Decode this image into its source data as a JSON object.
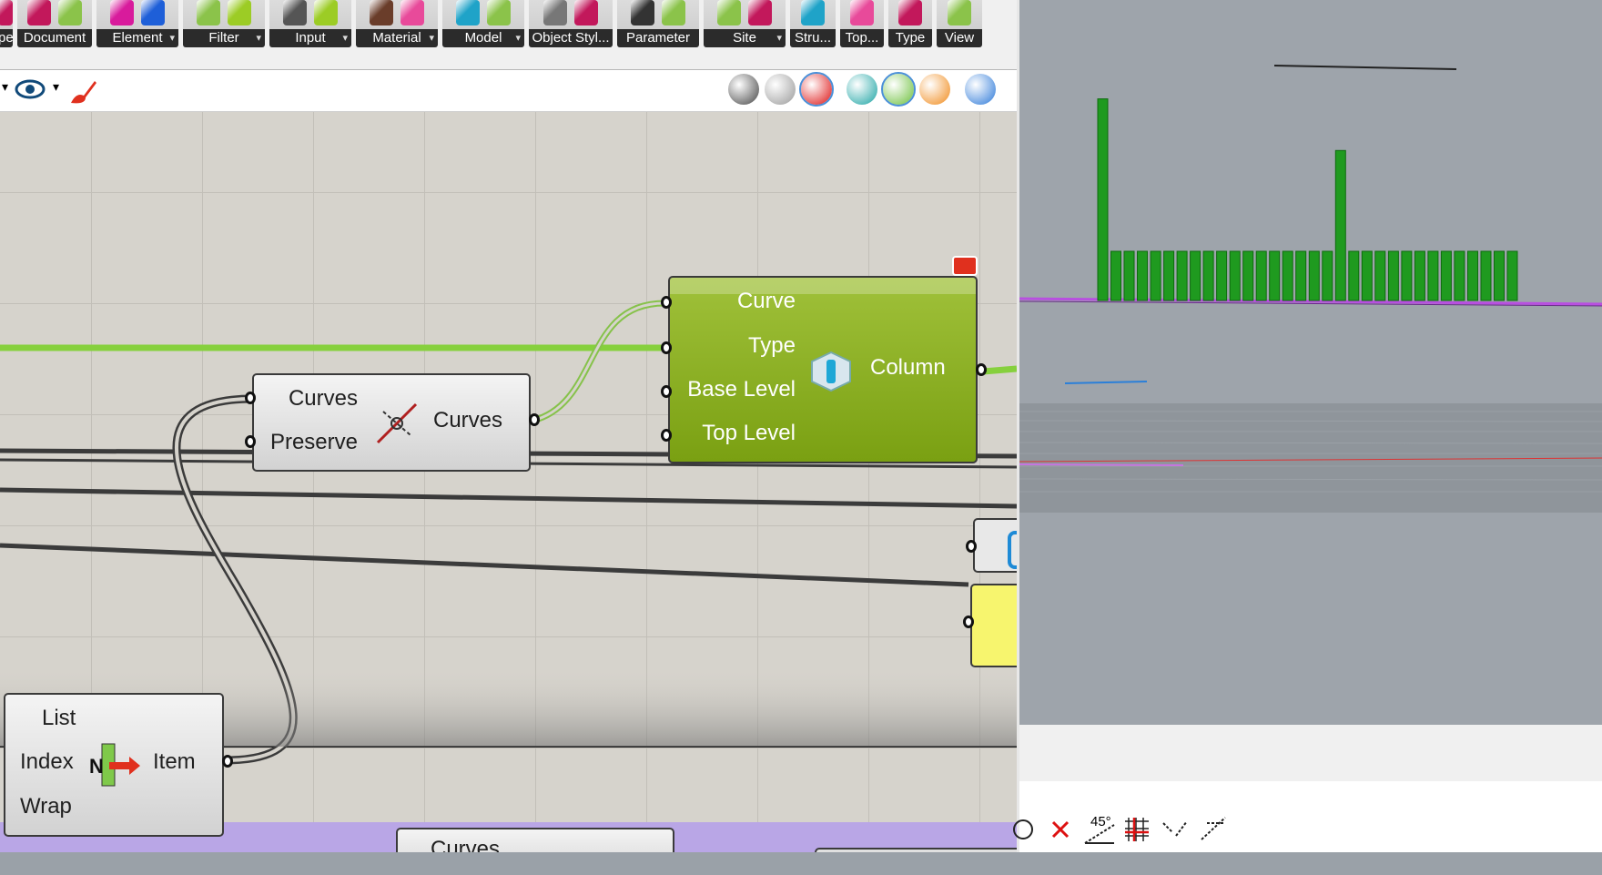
{
  "ribbon": {
    "tabs": [
      {
        "label": "pe",
        "icons": [
          "#c2185b"
        ],
        "arrow": false
      },
      {
        "label": "Document",
        "icons": [
          "#c2185b",
          "#8bc34a"
        ],
        "arrow": false
      },
      {
        "label": "Element",
        "icons": [
          "#d81b9c",
          "#1e5fd8"
        ],
        "arrow": true
      },
      {
        "label": "Filter",
        "icons": [
          "#8bc34a",
          "#9ccc25"
        ],
        "arrow": true
      },
      {
        "label": "Input",
        "icons": [
          "#555555",
          "#9ccc25"
        ],
        "arrow": true
      },
      {
        "label": "Material",
        "icons": [
          "#6a3d2a",
          "#e84a9a"
        ],
        "arrow": true
      },
      {
        "label": "Model",
        "icons": [
          "#1fa3c8",
          "#8bc34a"
        ],
        "arrow": true
      },
      {
        "label": "Object Styl...",
        "icons": [
          "#777777",
          "#c2185b"
        ],
        "arrow": false
      },
      {
        "label": "Parameter",
        "icons": [
          "#333333",
          "#8bc34a"
        ],
        "arrow": false
      },
      {
        "label": "Site",
        "icons": [
          "#8bc34a",
          "#c2185b"
        ],
        "arrow": true
      },
      {
        "label": "Stru...",
        "icons": [
          "#1fa3c8"
        ],
        "arrow": false
      },
      {
        "label": "Top...",
        "icons": [
          "#e84a9a"
        ],
        "arrow": false
      },
      {
        "label": "Type",
        "icons": [
          "#c2185b"
        ],
        "arrow": false
      },
      {
        "label": "View",
        "icons": [
          "#8bc34a"
        ],
        "arrow": false
      }
    ]
  },
  "canvas_toolbar": {
    "left_icons": [
      "eye-icon",
      "brush-icon"
    ],
    "right_icons": [
      "preview-off-icon",
      "wireframe-icon",
      "shaded-icon",
      "selected-only-icon",
      "selected-shaded-icon",
      "sphere-material-icon",
      "document-settings-icon"
    ]
  },
  "components": {
    "column": {
      "inputs": [
        "Curve",
        "Type",
        "Base Level",
        "Top Level"
      ],
      "output": "Column",
      "color": "#7fa31b"
    },
    "simplify": {
      "inputs": [
        "Curves",
        "Preserve"
      ],
      "output": "Curves"
    },
    "list_item": {
      "inputs": [
        "List",
        "Index",
        "Wrap"
      ],
      "output": "Item"
    },
    "bottom_partial": {
      "label": "Curves"
    }
  },
  "viewport": {
    "bar_color": "#1f9a1f",
    "column_heights": [
      0.82,
      0.2,
      0.2,
      0.2,
      0.2,
      0.2,
      0.2,
      0.2,
      0.2,
      0.2,
      0.2,
      0.2,
      0.2,
      0.2,
      0.2,
      0.2,
      0.2,
      0.2,
      0.61,
      0.2,
      0.2,
      0.2,
      0.2,
      0.2,
      0.2,
      0.2,
      0.2,
      0.2,
      0.2,
      0.2,
      0.2,
      0.2
    ]
  },
  "statusbar": {
    "icons": [
      "close-x-icon",
      "angle-45-icon",
      "grid-snap-icon",
      "ortho-icon",
      "planar-icon"
    ],
    "angle_label": "45°"
  }
}
